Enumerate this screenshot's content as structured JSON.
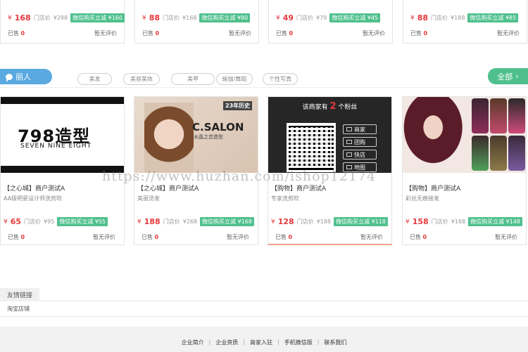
{
  "currency": "¥",
  "top_cards": [
    {
      "price": "168",
      "orig_label": "门店价",
      "orig": "¥288",
      "promo": "微信购买立减 ¥160",
      "sold_label": "已售",
      "sold": "0",
      "review": "暂无评价"
    },
    {
      "price": "88",
      "orig_label": "门店价",
      "orig": "¥168",
      "promo": "微信购买立减 ¥80",
      "sold_label": "已售",
      "sold": "0",
      "review": "暂无评价"
    },
    {
      "price": "49",
      "orig_label": "门店价",
      "orig": "¥79",
      "promo": "微信购买立减 ¥45",
      "sold_label": "已售",
      "sold": "0",
      "review": "暂无评价"
    },
    {
      "price": "88",
      "orig_label": "门店价",
      "orig": "¥188",
      "promo": "微信购买立减 ¥85",
      "sold_label": "已售",
      "sold": "0",
      "review": "暂无评价"
    }
  ],
  "category": {
    "title": "丽人",
    "tags": [
      "美发",
      "美容美体",
      "美甲",
      "瑜伽/舞蹈",
      "个性写真"
    ],
    "all_label": "全部",
    "all_arrow": "›"
  },
  "products": [
    {
      "title": "【之心城】商户测试A",
      "desc": "AA级明星设计师洗剪吹",
      "price": "65",
      "orig_label": "门店价",
      "orig": "¥95",
      "promo": "微信购买立减 ¥55",
      "sold_label": "已售",
      "sold": "0",
      "review": "暂无评价",
      "image": {
        "brand": "798造型",
        "sub": "SEVEN NINE EIGHT"
      }
    },
    {
      "title": "【之心城】商户测试A",
      "desc": "美丽烫发",
      "price": "188",
      "orig_label": "门店价",
      "orig": "¥268",
      "promo": "微信购买立减 ¥168",
      "sold_label": "已售",
      "sold": "0",
      "review": "暂无评价",
      "image": {
        "brand": "C.SALON",
        "sub": "水晶之恋造型",
        "years": "23年历史"
      }
    },
    {
      "title": "【购物】商户测试A",
      "desc": "专家洗剪吹",
      "price": "128",
      "orig_label": "门店价",
      "orig": "¥188",
      "promo": "微信购买立减 ¥118",
      "sold_label": "已售",
      "sold": "0",
      "review": "暂无评价",
      "image": {
        "head_pre": "该商家有",
        "head_num": "2",
        "head_post": "个粉丝",
        "menu": [
          "商家",
          "团购",
          "快店",
          "地图"
        ]
      }
    },
    {
      "title": "【购物】商户测试A",
      "desc": "彩丝无痕接发",
      "price": "158",
      "orig_label": "门店价",
      "orig": "¥168",
      "promo": "微信购买立减 ¥148",
      "sold_label": "已售",
      "sold": "0",
      "review": "暂无评价"
    }
  ],
  "watermark": "https://www.huzhan.com/ishop12174",
  "friend_links": {
    "title": "友情链接",
    "items": [
      "淘宝店铺"
    ]
  },
  "footer": {
    "links": [
      "企业简介",
      "企业资质",
      "商家入驻",
      "手机微信版",
      "联系我们"
    ],
    "sep": "|"
  },
  "colors": {
    "price": "#e4393c",
    "promo": "#4fc08d",
    "category": "#5aa9e0",
    "all_button": "#4fc08d"
  }
}
